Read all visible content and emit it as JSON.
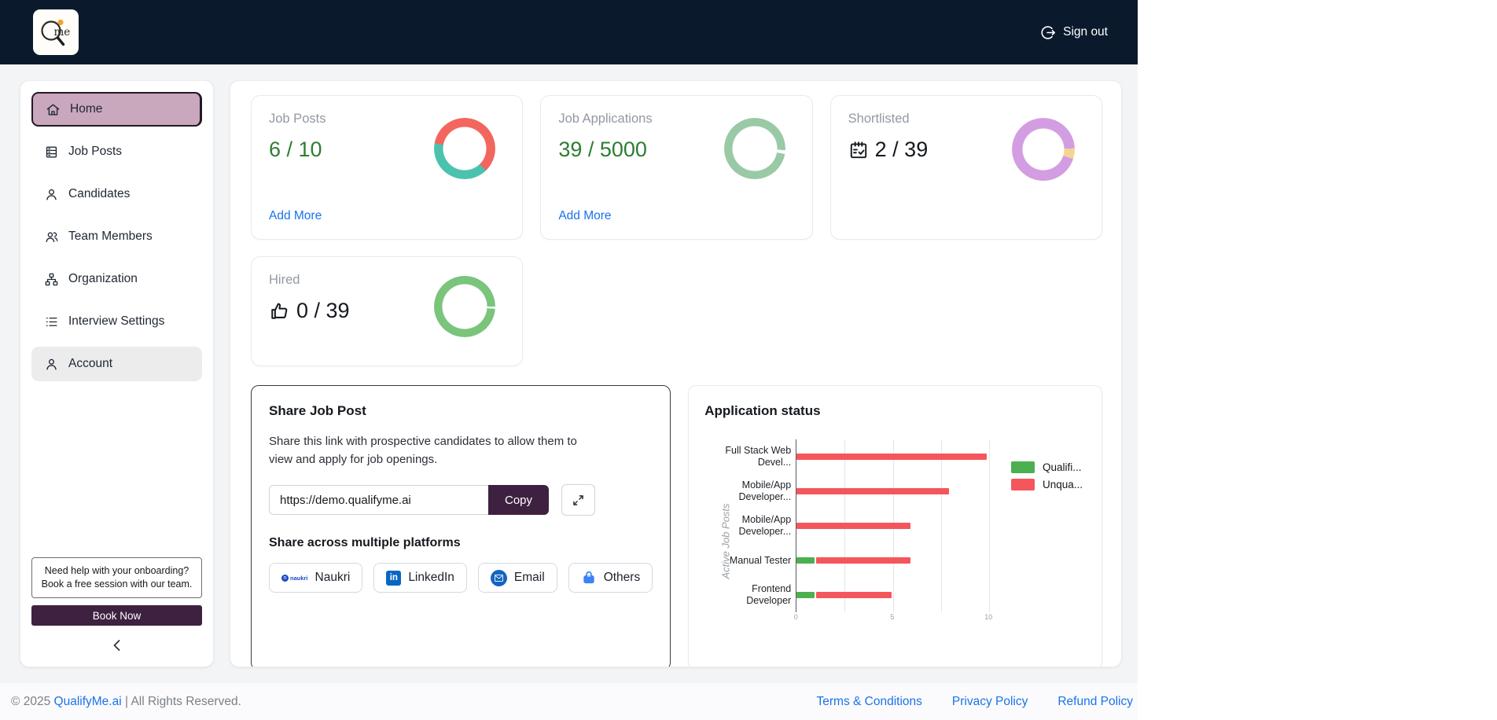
{
  "topbar": {
    "logo_text": "me",
    "signout_label": "Sign out"
  },
  "sidebar": {
    "items": [
      {
        "label": "Home",
        "icon": "home-icon",
        "active": true
      },
      {
        "label": "Job Posts",
        "icon": "server-icon"
      },
      {
        "label": "Candidates",
        "icon": "person-icon"
      },
      {
        "label": "Team Members",
        "icon": "people-icon"
      },
      {
        "label": "Organization",
        "icon": "sitemap-icon"
      },
      {
        "label": "Interview Settings",
        "icon": "list-icon"
      },
      {
        "label": "Account",
        "icon": "person-icon"
      }
    ],
    "help_text": "Need help with your onboarding? Book a free session with our team.",
    "book_now_label": "Book Now"
  },
  "stats": [
    {
      "label": "Job Posts",
      "value": "6 / 10",
      "link": "Add More",
      "donut": {
        "from": -80,
        "segments": [
          {
            "color": "#f2665f",
            "pct": 60
          },
          {
            "color": "#4ac2ae",
            "pct": 40
          }
        ]
      }
    },
    {
      "label": "Job Applications",
      "value": "39 / 5000",
      "link": "Add More",
      "donut": {
        "from": 93,
        "segments": [
          {
            "color": "#ffffff",
            "pct": 2
          },
          {
            "color": "#9ac9a5",
            "pct": 98
          }
        ]
      }
    },
    {
      "label": "Shortlisted",
      "value": "2 / 39",
      "icon": "calendar-check-icon",
      "donut": {
        "from": 88,
        "segments": [
          {
            "color": "#f3d492",
            "pct": 5.5
          },
          {
            "color": "#d39de1",
            "pct": 94.5
          }
        ]
      }
    },
    {
      "label": "Hired",
      "value": "0 / 39",
      "icon": "thumbs-up-icon",
      "donut": {
        "from": 90,
        "segments": [
          {
            "color": "#ffffff",
            "pct": 1.2
          },
          {
            "color": "#7ac47c",
            "pct": 98.8
          }
        ]
      }
    }
  ],
  "share": {
    "title": "Share Job Post",
    "description": "Share this link with prospective candidates to allow them to view and apply for job openings.",
    "url": "https://demo.qualifyme.ai",
    "copy_label": "Copy",
    "subtitle": "Share across multiple platforms",
    "platforms": [
      {
        "label": "Naukri",
        "icon": "naukri-icon",
        "icon_text": "naukri"
      },
      {
        "label": "LinkedIn",
        "icon": "linkedin-icon",
        "icon_text": "in"
      },
      {
        "label": "Email",
        "icon": "email-icon"
      },
      {
        "label": "Others",
        "icon": "briefcase-icon"
      }
    ]
  },
  "chart_data": {
    "type": "bar",
    "orientation": "horizontal-stacked",
    "title": "Application status",
    "categories": [
      "Full Stack Web Devel...",
      "Mobile/App Developer...",
      "Mobile/App Developer...",
      "Manual Tester",
      "Frontend Developer"
    ],
    "series": [
      {
        "name": "Qualifi...",
        "color": "#4caf50",
        "values": [
          0,
          0,
          0,
          1,
          1
        ]
      },
      {
        "name": "Unqua...",
        "color": "#f4565b",
        "values": [
          10,
          8,
          6,
          5,
          4
        ]
      }
    ],
    "xlabel": "",
    "ylabel": "Active Job Posts",
    "xlim": [
      0,
      10
    ],
    "xticks": [
      0,
      5,
      10
    ],
    "gridline_step": 2.5,
    "grid": true,
    "legend_position": "right-top"
  },
  "footer": {
    "copyright_prefix": "© 2025 ",
    "brand": "QualifyMe.ai",
    "copyright_suffix": " | All Rights Reserved.",
    "links": [
      "Terms & Conditions",
      "Privacy Policy",
      "Refund Policy"
    ]
  }
}
